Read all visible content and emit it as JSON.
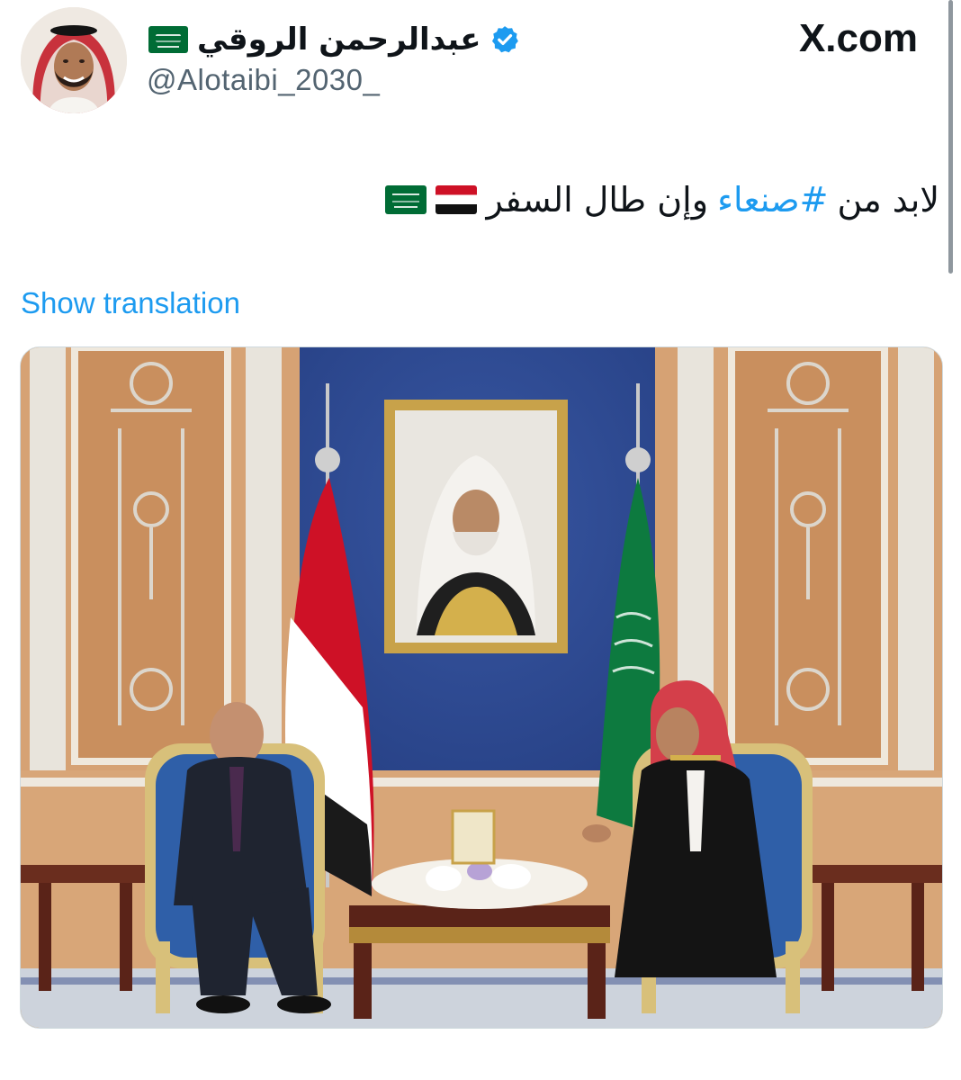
{
  "header": {
    "display_name": "عبدالرحمن الروقي",
    "handle": "@Alotaibi_2030_",
    "verified": true,
    "name_flag": "saudi-flag-emoji",
    "site_label": "X.com",
    "colors": {
      "verified": "#1d9bf0",
      "handle": "#536471"
    }
  },
  "tweet": {
    "text_before": "لابد من",
    "hashtag": "#صنعاء",
    "text_after": "وإن طال السفر",
    "emojis": [
      "yemen-flag-emoji",
      "saudi-flag-emoji"
    ],
    "translate_label": "Show translation",
    "colors": {
      "link": "#1d9bf0",
      "text": "#0f1419"
    }
  },
  "media": {
    "type": "photo"
  }
}
